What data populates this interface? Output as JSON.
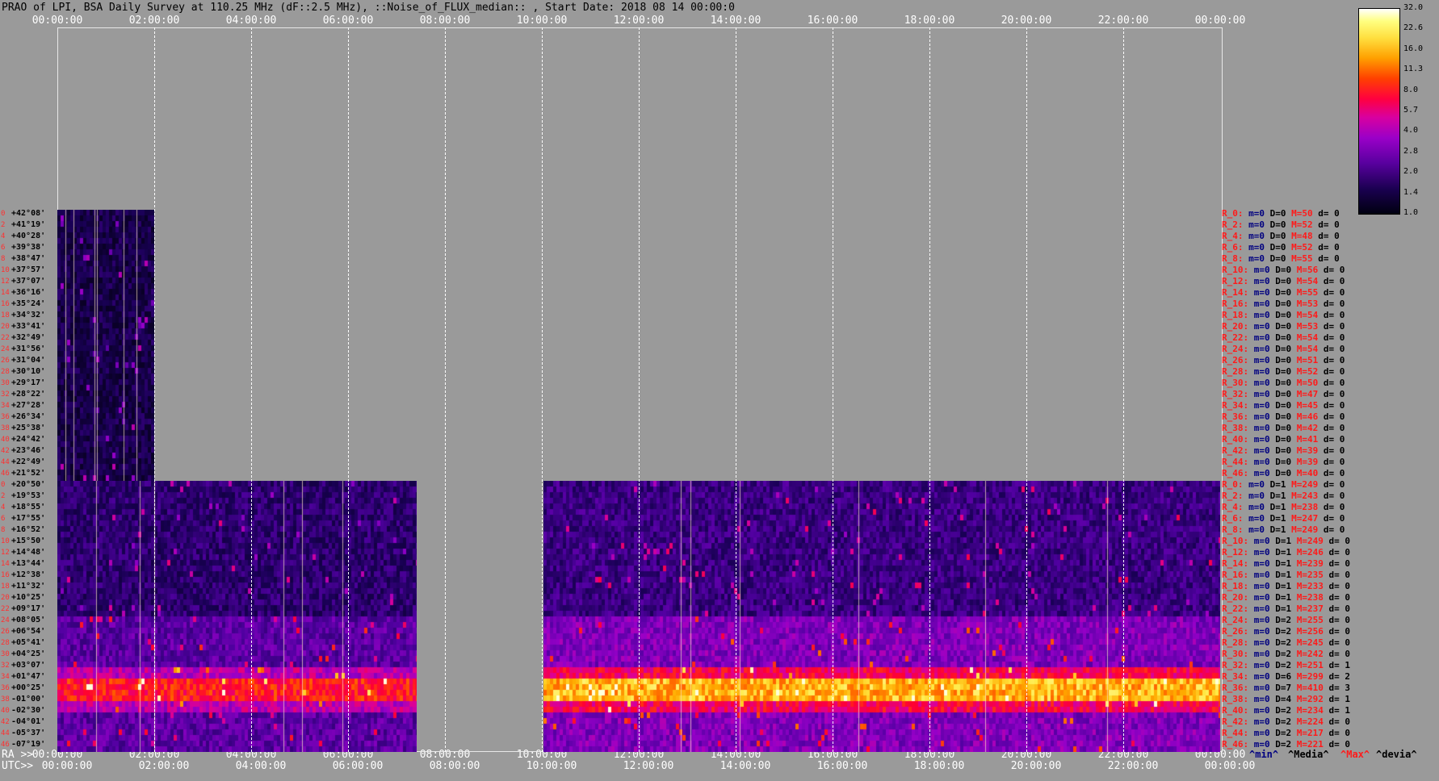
{
  "title": "PRAO of LPI, BSA Daily Survey at 110.25 MHz (dF::2.5 MHz), ::Noise_of_FLUX_median:: , Start Date: 2018 08 14 00:00:0",
  "time_labels": [
    "00:00:00",
    "02:00:00",
    "04:00:00",
    "06:00:00",
    "08:00:00",
    "10:00:00",
    "12:00:00",
    "14:00:00",
    "16:00:00",
    "18:00:00",
    "20:00:00",
    "22:00:00",
    "00:00:00"
  ],
  "ra_prefix": "RA >>",
  "utc_prefix": "UTC>>",
  "colorbar": {
    "ticks": [
      "32.0",
      "22.6",
      "16.0",
      "11.3",
      "8.0",
      "5.7",
      "4.0",
      "2.8",
      "2.0",
      "1.4",
      "1.0"
    ]
  },
  "legend": {
    "min": "^min^",
    "median": "^Media^",
    "max": "^Max^",
    "devia": "^devia^"
  },
  "row_indices_upper": [
    "0",
    "2",
    "4",
    "6",
    "8",
    "10",
    "12",
    "14",
    "16",
    "18",
    "20",
    "22",
    "24",
    "26",
    "28",
    "30",
    "32",
    "34",
    "36",
    "38",
    "40",
    "42",
    "44",
    "46"
  ],
  "declinations_upper": [
    "+42°08'",
    "+41°19'",
    "+40°28'",
    "+39°38'",
    "+38°47'",
    "+37°57'",
    "+37°07'",
    "+36°16'",
    "+35°24'",
    "+34°32'",
    "+33°41'",
    "+32°49'",
    "+31°56'",
    "+31°04'",
    "+30°10'",
    "+29°17'",
    "+28°22'",
    "+27°28'",
    "+26°34'",
    "+25°38'",
    "+24°42'",
    "+23°46'",
    "+22°49'",
    "+21°52'"
  ],
  "row_indices_lower": [
    "0",
    "2",
    "4",
    "6",
    "8",
    "10",
    "12",
    "14",
    "16",
    "18",
    "20",
    "22",
    "24",
    "26",
    "28",
    "30",
    "32",
    "34",
    "36",
    "38",
    "40",
    "42",
    "44",
    "46"
  ],
  "declinations_lower": [
    "+20°50'",
    "+19°53'",
    "+18°55'",
    "+17°55'",
    "+16°52'",
    "+15°50'",
    "+14°48'",
    "+13°44'",
    "+12°38'",
    "+11°32'",
    "+10°25'",
    "+09°17'",
    "+08°05'",
    "+06°54'",
    "+05°41'",
    "+04°25'",
    "+03°07'",
    "+01°47'",
    "+00°25'",
    "-01°00'",
    "-02°30'",
    "-04°01'",
    "-05°37'",
    "-07°19'"
  ],
  "stats_upper": [
    {
      "r": "R_0:",
      "m": "m=0",
      "d": "D=0",
      "M": "M=50",
      "dv": "d= 0"
    },
    {
      "r": "R_2:",
      "m": "m=0",
      "d": "D=0",
      "M": "M=52",
      "dv": "d= 0"
    },
    {
      "r": "R_4:",
      "m": "m=0",
      "d": "D=0",
      "M": "M=48",
      "dv": "d= 0"
    },
    {
      "r": "R_6:",
      "m": "m=0",
      "d": "D=0",
      "M": "M=52",
      "dv": "d= 0"
    },
    {
      "r": "R_8:",
      "m": "m=0",
      "d": "D=0",
      "M": "M=55",
      "dv": "d= 0"
    },
    {
      "r": "R_10:",
      "m": "m=0",
      "d": "D=0",
      "M": "M=56",
      "dv": "d= 0"
    },
    {
      "r": "R_12:",
      "m": "m=0",
      "d": "D=0",
      "M": "M=54",
      "dv": "d= 0"
    },
    {
      "r": "R_14:",
      "m": "m=0",
      "d": "D=0",
      "M": "M=55",
      "dv": "d= 0"
    },
    {
      "r": "R_16:",
      "m": "m=0",
      "d": "D=0",
      "M": "M=53",
      "dv": "d= 0"
    },
    {
      "r": "R_18:",
      "m": "m=0",
      "d": "D=0",
      "M": "M=54",
      "dv": "d= 0"
    },
    {
      "r": "R_20:",
      "m": "m=0",
      "d": "D=0",
      "M": "M=53",
      "dv": "d= 0"
    },
    {
      "r": "R_22:",
      "m": "m=0",
      "d": "D=0",
      "M": "M=54",
      "dv": "d= 0"
    },
    {
      "r": "R_24:",
      "m": "m=0",
      "d": "D=0",
      "M": "M=54",
      "dv": "d= 0"
    },
    {
      "r": "R_26:",
      "m": "m=0",
      "d": "D=0",
      "M": "M=51",
      "dv": "d= 0"
    },
    {
      "r": "R_28:",
      "m": "m=0",
      "d": "D=0",
      "M": "M=52",
      "dv": "d= 0"
    },
    {
      "r": "R_30:",
      "m": "m=0",
      "d": "D=0",
      "M": "M=50",
      "dv": "d= 0"
    },
    {
      "r": "R_32:",
      "m": "m=0",
      "d": "D=0",
      "M": "M=47",
      "dv": "d= 0"
    },
    {
      "r": "R_34:",
      "m": "m=0",
      "d": "D=0",
      "M": "M=45",
      "dv": "d= 0"
    },
    {
      "r": "R_36:",
      "m": "m=0",
      "d": "D=0",
      "M": "M=46",
      "dv": "d= 0"
    },
    {
      "r": "R_38:",
      "m": "m=0",
      "d": "D=0",
      "M": "M=42",
      "dv": "d= 0"
    },
    {
      "r": "R_40:",
      "m": "m=0",
      "d": "D=0",
      "M": "M=41",
      "dv": "d= 0"
    },
    {
      "r": "R_42:",
      "m": "m=0",
      "d": "D=0",
      "M": "M=39",
      "dv": "d= 0"
    },
    {
      "r": "R_44:",
      "m": "m=0",
      "d": "D=0",
      "M": "M=39",
      "dv": "d= 0"
    },
    {
      "r": "R_46:",
      "m": "m=0",
      "d": "D=0",
      "M": "M=40",
      "dv": "d= 0"
    }
  ],
  "stats_lower": [
    {
      "r": "R_0:",
      "m": "m=0",
      "d": "D=1",
      "M": "M=249",
      "dv": "d= 0"
    },
    {
      "r": "R_2:",
      "m": "m=0",
      "d": "D=1",
      "M": "M=243",
      "dv": "d= 0"
    },
    {
      "r": "R_4:",
      "m": "m=0",
      "d": "D=1",
      "M": "M=238",
      "dv": "d= 0"
    },
    {
      "r": "R_6:",
      "m": "m=0",
      "d": "D=1",
      "M": "M=247",
      "dv": "d= 0"
    },
    {
      "r": "R_8:",
      "m": "m=0",
      "d": "D=1",
      "M": "M=249",
      "dv": "d= 0"
    },
    {
      "r": "R_10:",
      "m": "m=0",
      "d": "D=1",
      "M": "M=249",
      "dv": "d= 0"
    },
    {
      "r": "R_12:",
      "m": "m=0",
      "d": "D=1",
      "M": "M=246",
      "dv": "d= 0"
    },
    {
      "r": "R_14:",
      "m": "m=0",
      "d": "D=1",
      "M": "M=239",
      "dv": "d= 0"
    },
    {
      "r": "R_16:",
      "m": "m=0",
      "d": "D=1",
      "M": "M=235",
      "dv": "d= 0"
    },
    {
      "r": "R_18:",
      "m": "m=0",
      "d": "D=1",
      "M": "M=233",
      "dv": "d= 0"
    },
    {
      "r": "R_20:",
      "m": "m=0",
      "d": "D=1",
      "M": "M=238",
      "dv": "d= 0"
    },
    {
      "r": "R_22:",
      "m": "m=0",
      "d": "D=1",
      "M": "M=237",
      "dv": "d= 0"
    },
    {
      "r": "R_24:",
      "m": "m=0",
      "d": "D=2",
      "M": "M=255",
      "dv": "d= 0"
    },
    {
      "r": "R_26:",
      "m": "m=0",
      "d": "D=2",
      "M": "M=256",
      "dv": "d= 0"
    },
    {
      "r": "R_28:",
      "m": "m=0",
      "d": "D=2",
      "M": "M=245",
      "dv": "d= 0"
    },
    {
      "r": "R_30:",
      "m": "m=0",
      "d": "D=2",
      "M": "M=242",
      "dv": "d= 0"
    },
    {
      "r": "R_32:",
      "m": "m=0",
      "d": "D=2",
      "M": "M=251",
      "dv": "d= 1"
    },
    {
      "r": "R_34:",
      "m": "m=0",
      "d": "D=6",
      "M": "M=299",
      "dv": "d= 2"
    },
    {
      "r": "R_36:",
      "m": "m=0",
      "d": "D=7",
      "M": "M=410",
      "dv": "d= 3"
    },
    {
      "r": "R_38:",
      "m": "m=0",
      "d": "D=4",
      "M": "M=292",
      "dv": "d= 1"
    },
    {
      "r": "R_40:",
      "m": "m=0",
      "d": "D=2",
      "M": "M=234",
      "dv": "d= 1"
    },
    {
      "r": "R_42:",
      "m": "m=0",
      "d": "D=2",
      "M": "M=224",
      "dv": "d= 0"
    },
    {
      "r": "R_44:",
      "m": "m=0",
      "d": "D=2",
      "M": "M=217",
      "dv": "d= 0"
    },
    {
      "r": "R_46:",
      "m": "m=0",
      "d": "D=2",
      "M": "M=221",
      "dv": "d= 0"
    }
  ],
  "chart_data": {
    "type": "heatmap",
    "title": "PRAO of LPI, BSA Daily Survey at 110.25 MHz (dF::2.5 MHz), ::Noise_of_FLUX_median:: , Start Date: 2018 08 14 00:00:0",
    "x_range_utc_hours": [
      0,
      24
    ],
    "colorscale_range": [
      1.0,
      32.0
    ],
    "colorscale_log": true,
    "data_segments": [
      {
        "name": "upper beams (+42°08' to +21°52')",
        "utc_start_hours": 0,
        "utc_end_hours": 2,
        "level": "low"
      },
      {
        "name": "lower beams (+20°50' to -07°19')",
        "utc_start_hours": 0,
        "utc_end_hours": 7.3,
        "level": "medium"
      },
      {
        "name": "lower beams (+20°50' to -07°19')",
        "utc_start_hours": 10,
        "utc_end_hours": 24,
        "level": "medium-high"
      }
    ]
  }
}
